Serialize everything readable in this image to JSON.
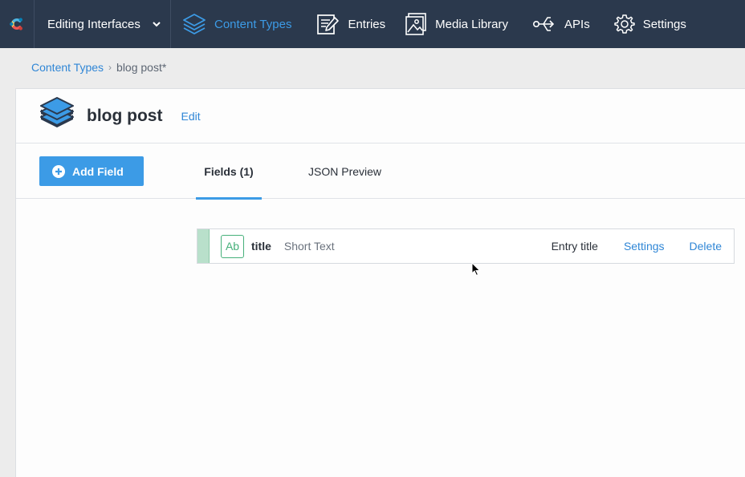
{
  "topnav": {
    "space_name": "Editing Interfaces",
    "items": [
      {
        "label": "Content Types",
        "icon": "layers-icon",
        "active": true
      },
      {
        "label": "Entries",
        "icon": "entries-edit-icon"
      },
      {
        "label": "Media Library",
        "icon": "image-icon"
      },
      {
        "label": "APIs",
        "icon": "api-share-icon"
      },
      {
        "label": "Settings",
        "icon": "gear-icon"
      }
    ]
  },
  "breadcrumb": {
    "parent": "Content Types",
    "separator": "›",
    "current": "blog post*"
  },
  "content_type": {
    "name": "blog post",
    "edit_label": "Edit"
  },
  "toolbar": {
    "add_field_label": "Add Field",
    "tabs": [
      {
        "label": "Fields (1)",
        "active": true
      },
      {
        "label": "JSON Preview"
      }
    ]
  },
  "fields": [
    {
      "type_badge": "Ab",
      "name": "title",
      "type": "Short Text",
      "entry_title_label": "Entry title",
      "settings_label": "Settings",
      "delete_label": "Delete"
    }
  ],
  "colors": {
    "nav_bg": "#2b394d",
    "accent": "#3c9be6",
    "link": "#2f86d6",
    "field_green": "#46b07a"
  }
}
